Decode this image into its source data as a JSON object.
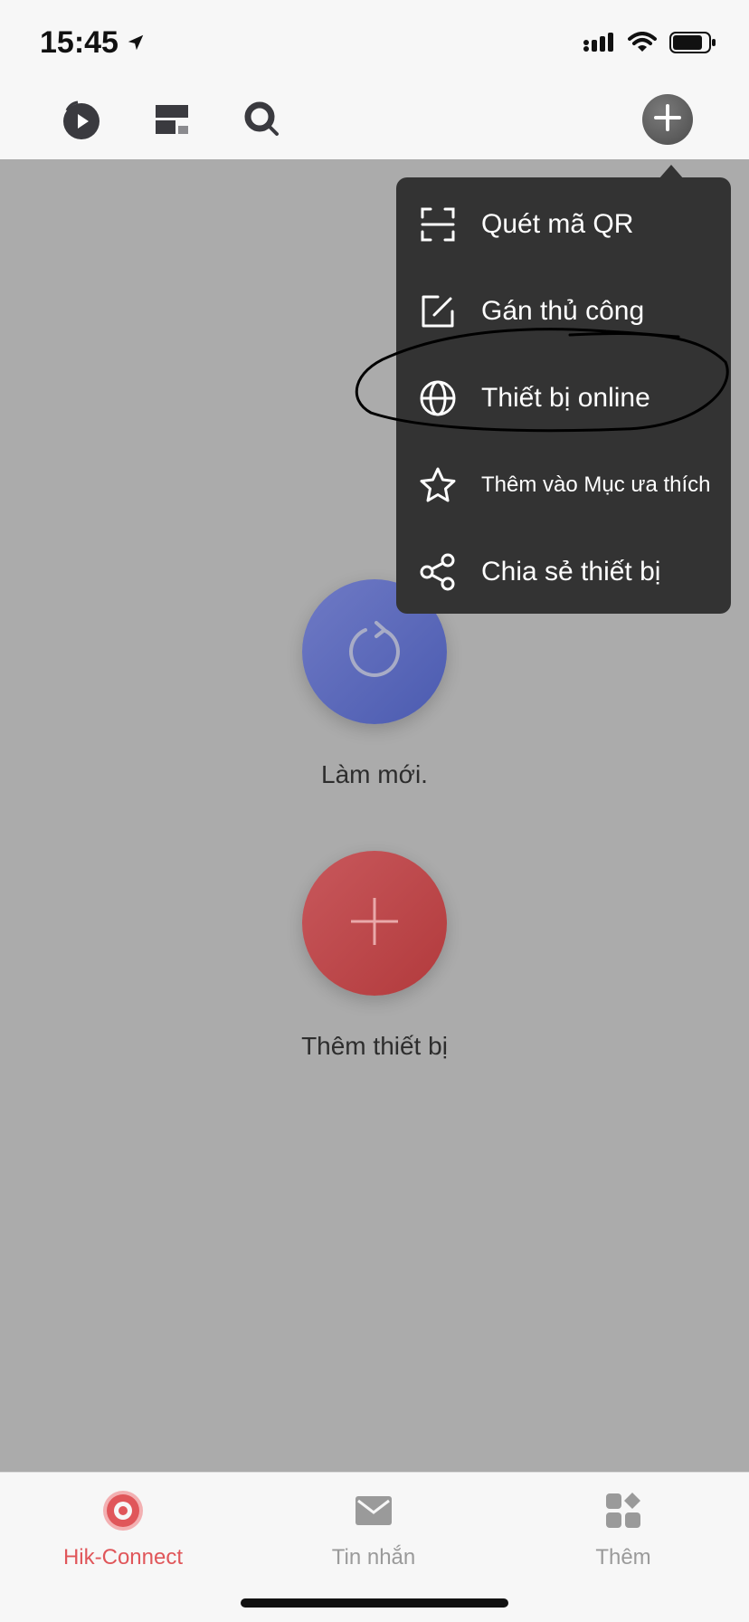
{
  "status": {
    "time": "15:45"
  },
  "menu": {
    "items": [
      {
        "label": "Quét mã QR",
        "icon": "qr-scan-icon"
      },
      {
        "label": "Gán thủ công",
        "icon": "edit-icon"
      },
      {
        "label": "Thiết bị online",
        "icon": "globe-icon"
      },
      {
        "label": "Thêm vào Mục ưa thích",
        "icon": "star-icon"
      },
      {
        "label": "Chia sẻ thiết bị",
        "icon": "share-icon"
      }
    ]
  },
  "main": {
    "refresh_label": "Làm mới.",
    "add_device_label": "Thêm thiết bị"
  },
  "tabs": [
    {
      "label": "Hik-Connect",
      "icon": "hik-connect-icon",
      "active": true
    },
    {
      "label": "Tin nhắn",
      "icon": "mail-icon",
      "active": false
    },
    {
      "label": "Thêm",
      "icon": "apps-icon",
      "active": false
    }
  ],
  "colors": {
    "accent": "#e0565a",
    "menu_bg": "#333333",
    "overlay_bg": "#ababab",
    "refresh_blue": "#5663b8",
    "add_red": "#bc4548"
  }
}
